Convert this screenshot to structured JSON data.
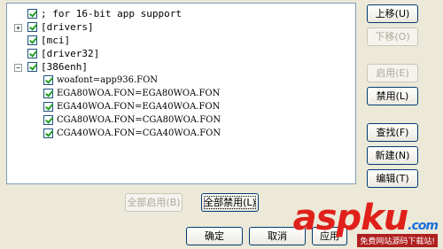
{
  "tree": {
    "items": [
      {
        "label": "; for 16-bit app support"
      },
      {
        "label": "[drivers]"
      },
      {
        "label": "[mci]"
      },
      {
        "label": "[driver32]"
      },
      {
        "label": "[386enh]"
      },
      {
        "label": "woafont=app936.FON"
      },
      {
        "label": "EGA80WOA.FON=EGA80WOA.FON"
      },
      {
        "label": "EGA40WOA.FON=EGA40WOA.FON"
      },
      {
        "label": "CGA80WOA.FON=CGA80WOA.FON"
      },
      {
        "label": "CGA40WOA.FON=CGA40WOA.FON"
      }
    ]
  },
  "side": {
    "move_up": "上移(U)",
    "move_down": "下移(O)",
    "enable": "启用(E)",
    "disable": "禁用(L)",
    "find": "查找(F)",
    "new": "新建(N)",
    "edit": "编辑(T)"
  },
  "bottom": {
    "enable_all": "全部启用(B)",
    "disable_all": "全部禁用(L)",
    "ok": "确定",
    "cancel": "取消",
    "apply": "应用"
  },
  "watermark": {
    "text_a": "asp",
    "text_b": "ku",
    "text_c": ".com",
    "sub": "免费网站源码下载站!"
  }
}
